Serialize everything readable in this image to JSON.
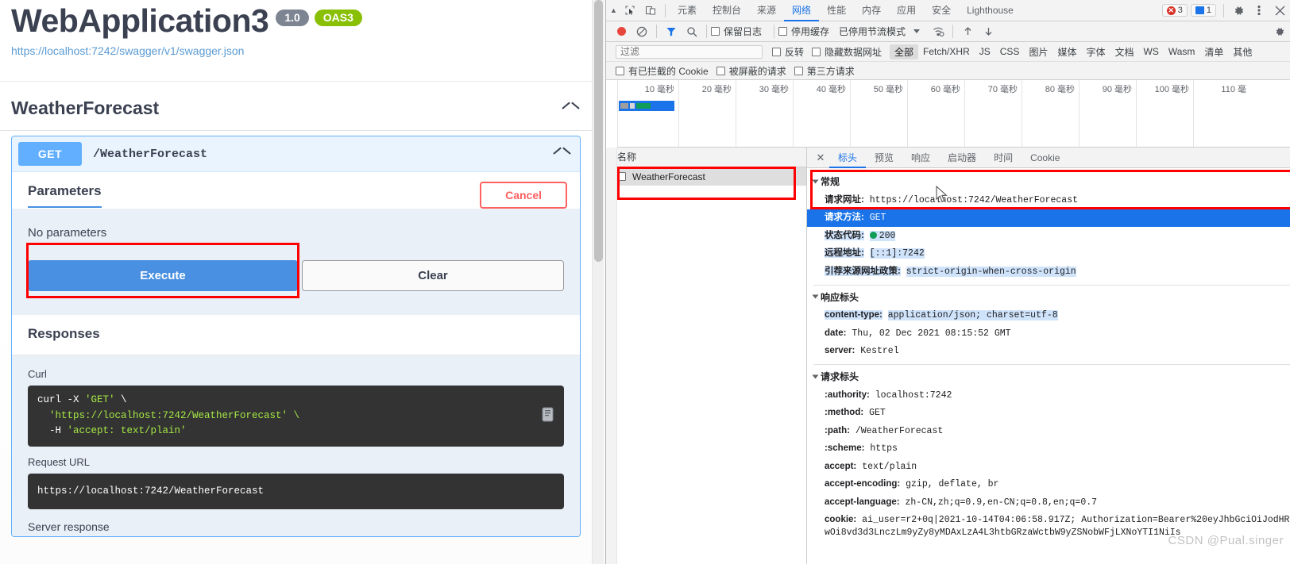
{
  "swagger": {
    "title": "WebApplication3",
    "version_badge": "1.0",
    "oas_badge": "OAS3",
    "spec_url": "https://localhost:7242/swagger/v1/swagger.json",
    "tag_name": "WeatherForecast",
    "operation": {
      "method": "GET",
      "path": "/WeatherForecast"
    },
    "parameters": {
      "section_title": "Parameters",
      "cancel_label": "Cancel",
      "empty_text": "No parameters",
      "execute_label": "Execute",
      "clear_label": "Clear"
    },
    "responses": {
      "section_title": "Responses",
      "curl_label": "Curl",
      "curl_cmd_line1_a": "curl -X ",
      "curl_cmd_line1_b": "'GET'",
      "curl_cmd_line1_c": " \\",
      "curl_cmd_line2": "  'https://localhost:7242/WeatherForecast' \\",
      "curl_cmd_line3_a": "  -H ",
      "curl_cmd_line3_b": "'accept: text/plain'",
      "request_url_label": "Request URL",
      "request_url_value": "https://localhost:7242/WeatherForecast",
      "server_response_label": "Server response"
    }
  },
  "devtools": {
    "tabs": [
      {
        "label": "元素",
        "active": false
      },
      {
        "label": "控制台",
        "active": false
      },
      {
        "label": "来源",
        "active": false
      },
      {
        "label": "网络",
        "active": true
      },
      {
        "label": "性能",
        "active": false
      },
      {
        "label": "内存",
        "active": false
      },
      {
        "label": "应用",
        "active": false
      },
      {
        "label": "安全",
        "active": false
      },
      {
        "label": "Lighthouse",
        "active": false
      }
    ],
    "error_count": "3",
    "message_count": "1",
    "toolbar2": {
      "preserve_log_label": "保留日志",
      "disable_cache_label": "停用缓存",
      "throttle_label": "已停用节流模式"
    },
    "filter_bar": {
      "filter_placeholder": "过滤",
      "invert_label": "反转",
      "hide_data_urls_label": "隐藏数据网址",
      "types": [
        {
          "label": "全部",
          "active": true
        },
        {
          "label": "Fetch/XHR",
          "active": false
        },
        {
          "label": "JS",
          "active": false
        },
        {
          "label": "CSS",
          "active": false
        },
        {
          "label": "图片",
          "active": false
        },
        {
          "label": "媒体",
          "active": false
        },
        {
          "label": "字体",
          "active": false
        },
        {
          "label": "文档",
          "active": false
        },
        {
          "label": "WS",
          "active": false
        },
        {
          "label": "Wasm",
          "active": false
        },
        {
          "label": "清单",
          "active": false
        },
        {
          "label": "其他",
          "active": false
        }
      ],
      "blocked_cookies_label": "有已拦截的 Cookie",
      "blocked_requests_label": "被屏蔽的请求",
      "third_party_label": "第三方请求"
    },
    "timeline_ticks": [
      "10 毫秒",
      "20 毫秒",
      "30 毫秒",
      "40 毫秒",
      "50 毫秒",
      "60 毫秒",
      "70 毫秒",
      "80 毫秒",
      "90 毫秒",
      "100 毫秒",
      "110 毫"
    ],
    "request_list": {
      "column_header": "名称",
      "rows": [
        {
          "name": "WeatherForecast"
        }
      ]
    },
    "detail_tabs": [
      {
        "label": "标头",
        "active": true
      },
      {
        "label": "预览",
        "active": false
      },
      {
        "label": "响应",
        "active": false
      },
      {
        "label": "启动器",
        "active": false
      },
      {
        "label": "时间",
        "active": false
      },
      {
        "label": "Cookie",
        "active": false
      }
    ],
    "headers": {
      "general": {
        "title": "常规",
        "rows": [
          {
            "key": "请求网址:",
            "value": "https://localhost:7242/WeatherForecast",
            "style": "plain"
          },
          {
            "key": "请求方法:",
            "value": "GET",
            "style": "selected"
          },
          {
            "key": "状态代码:",
            "value": "200",
            "style": "lite",
            "status_dot": true
          },
          {
            "key": "远程地址:",
            "value": "[::1]:7242",
            "style": "lite"
          },
          {
            "key": "引荐来源网址政策:",
            "value": "strict-origin-when-cross-origin",
            "style": "lite"
          }
        ]
      },
      "response": {
        "title": "响应标头",
        "rows": [
          {
            "key": "content-type:",
            "value": "application/json; charset=utf-8",
            "style": "lite"
          },
          {
            "key": "date:",
            "value": "Thu, 02 Dec 2021 08:15:52 GMT",
            "style": "plain"
          },
          {
            "key": "server:",
            "value": "Kestrel",
            "style": "plain"
          }
        ]
      },
      "request": {
        "title": "请求标头",
        "rows": [
          {
            "key": ":authority:",
            "value": "localhost:7242",
            "style": "plain"
          },
          {
            "key": ":method:",
            "value": "GET",
            "style": "plain"
          },
          {
            "key": ":path:",
            "value": "/WeatherForecast",
            "style": "plain"
          },
          {
            "key": ":scheme:",
            "value": "https",
            "style": "plain"
          },
          {
            "key": "accept:",
            "value": "text/plain",
            "style": "plain"
          },
          {
            "key": "accept-encoding:",
            "value": "gzip, deflate, br",
            "style": "plain"
          },
          {
            "key": "accept-language:",
            "value": "zh-CN,zh;q=0.9,en-CN;q=0.8,en;q=0.7",
            "style": "plain"
          },
          {
            "key": "cookie:",
            "value": "ai_user=r2+0q|2021-10-14T04:06:58.917Z; Authorization=Bearer%20eyJhbGciOiJodHRwOi8vd3d3LnczLm9yZy8yMDAxLzA4L3htbGRzaWctbW9yZSNobWFjLXNoYTI1NiIs",
            "style": "plain"
          }
        ]
      }
    },
    "watermark": "CSDN @Pual.singer"
  }
}
